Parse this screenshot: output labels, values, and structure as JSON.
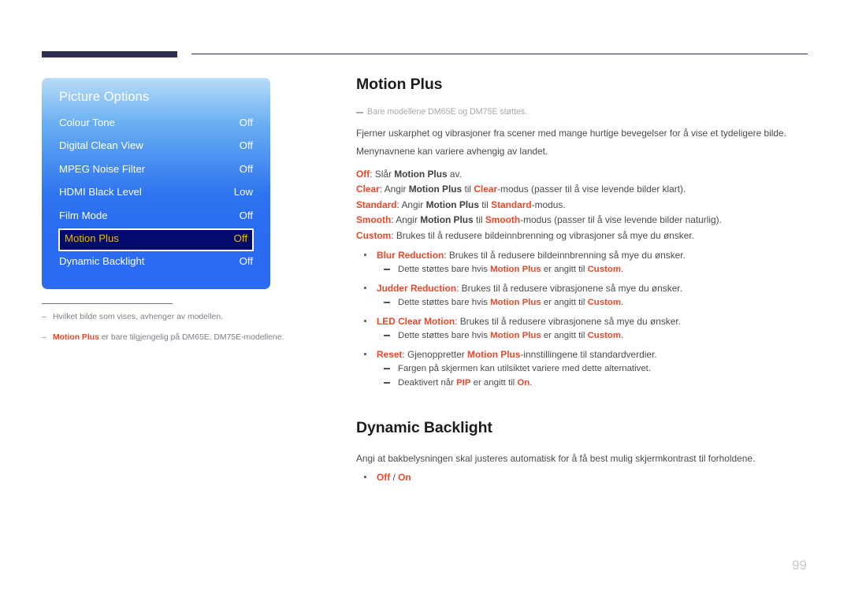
{
  "page": {
    "number": "99"
  },
  "osd": {
    "title": "Picture Options",
    "rows": [
      {
        "label": "Colour Tone",
        "value": "Off",
        "selected": false
      },
      {
        "label": "Digital Clean View",
        "value": "Off",
        "selected": false
      },
      {
        "label": "MPEG Noise Filter",
        "value": "Off",
        "selected": false
      },
      {
        "label": "HDMI Black Level",
        "value": "Low",
        "selected": false
      },
      {
        "label": "Film Mode",
        "value": "Off",
        "selected": false
      },
      {
        "label": "Motion Plus",
        "value": "Off",
        "selected": true
      },
      {
        "label": "Dynamic Backlight",
        "value": "Off",
        "selected": false
      }
    ],
    "colors": {
      "panel_blue": "#2a6bf2",
      "selected_bg": "#020a6e",
      "selected_text": "#f2b800"
    }
  },
  "left_notes": {
    "note1_dash": "–",
    "note1": "Hvilket bilde som vises, avhenger av modellen.",
    "note2_dash": "–",
    "note2_bold": "Motion Plus",
    "note2_rest": " er bare tilgjengelig på DM65E, DM75E-modellene."
  },
  "section1": {
    "title": "Motion Plus",
    "note": "Bare modellene DM65E og DM75E støttes.",
    "para1": "Fjerner uskarphet og vibrasjoner fra scener med mange hurtige bevegelser for å vise et tydeligere bilde.",
    "para2": "Menynavnene kan variere avhengig av landet.",
    "options": [
      {
        "name": "Off",
        "text_a": ": Slår ",
        "bold_mid": "Motion Plus",
        "text_b": " av."
      },
      {
        "name": "Clear",
        "text_a": ": Angir ",
        "bold_mid": "Motion Plus",
        "text_b": " til ",
        "bold_mid2": "Clear",
        "text_c": "-modus (passer til å vise levende bilder klart)."
      },
      {
        "name": "Standard",
        "text_a": ": Angir ",
        "bold_mid": "Motion Plus",
        "text_b": " til ",
        "bold_mid2": "Standard",
        "text_c": "-modus."
      },
      {
        "name": "Smooth",
        "text_a": ": Angir ",
        "bold_mid": "Motion Plus",
        "text_b": " til ",
        "bold_mid2": "Smooth",
        "text_c": "-modus (passer til å vise levende bilder naturlig)."
      },
      {
        "name": "Custom",
        "text_a": ": Brukes til å redusere bildeinnbrenning og vibrasjoner så mye du ønsker."
      }
    ],
    "bullets": [
      {
        "label": "Blur Reduction",
        "text": ": Brukes til å redusere bildeinnbrenning så mye du ønsker.",
        "subs": [
          {
            "pre": "Dette støttes bare hvis ",
            "b1": "Motion Plus",
            "mid": " er angitt til ",
            "b2": "Custom",
            "post": "."
          }
        ]
      },
      {
        "label": "Judder Reduction",
        "text": ": Brukes til å redusere vibrasjonene så mye du ønsker.",
        "subs": [
          {
            "pre": "Dette støttes bare hvis ",
            "b1": "Motion Plus",
            "mid": " er angitt til ",
            "b2": "Custom",
            "post": "."
          }
        ]
      },
      {
        "label": "LED Clear Motion",
        "text": ": Brukes til å redusere vibrasjonene så mye du ønsker.",
        "subs": [
          {
            "pre": "Dette støttes bare hvis ",
            "b1": "Motion Plus",
            "mid": " er angitt til ",
            "b2": "Custom",
            "post": "."
          }
        ]
      },
      {
        "label": "Reset",
        "text": ": Gjenoppretter ",
        "text_bold2": "Motion Plus",
        "text_tail": "-innstillingene til standardverdier.",
        "subs": [
          {
            "pre": "Fargen på skjermen kan utilsiktet variere med dette alternativet."
          },
          {
            "pre": "Deaktivert når ",
            "b1": "PIP",
            "mid": " er angitt til ",
            "b2": "On",
            "post": "."
          }
        ]
      }
    ]
  },
  "section2": {
    "title": "Dynamic Backlight",
    "para1": "Angi at bakbelysningen skal justeres automatisk for å få best mulig skjermkontrast til forholdene.",
    "option_off": "Off",
    "option_sep": " / ",
    "option_on": "On"
  }
}
